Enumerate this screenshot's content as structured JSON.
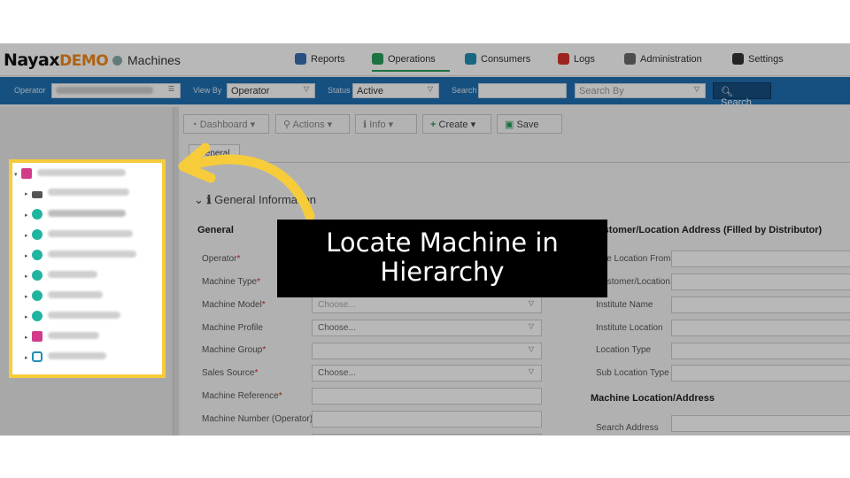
{
  "app": {
    "brand": "Nayax",
    "brand_suffix": "DEMO",
    "page": "Machines"
  },
  "nav": [
    {
      "label": "Reports",
      "icon": "reports-icon",
      "color": "#3b6fb5"
    },
    {
      "label": "Operations",
      "icon": "operations-icon",
      "color": "#2a9d5a"
    },
    {
      "label": "Consumers",
      "icon": "consumers-icon",
      "color": "#1f8fb5"
    },
    {
      "label": "Logs",
      "icon": "logs-icon",
      "color": "#d9342b"
    },
    {
      "label": "Administration",
      "icon": "administration-icon",
      "color": "#6b6b6b"
    },
    {
      "label": "Settings",
      "icon": "settings-icon",
      "color": "#333333"
    }
  ],
  "filters": {
    "operator_label": "Operator",
    "viewby_label": "View By",
    "viewby_value": "Operator",
    "status_label": "Status",
    "status_value": "Active",
    "search_label": "Search",
    "search_by_placeholder": "Search By",
    "search_button": "Search"
  },
  "toolbar": {
    "dashboard": "Dashboard",
    "actions": "Actions",
    "info": "Info",
    "create": "Create",
    "save": "Save"
  },
  "tabs": {
    "general": "General"
  },
  "form": {
    "section_title": "General Information",
    "general_header": "General",
    "fields": [
      {
        "label": "Operator",
        "required": true,
        "value": ""
      },
      {
        "label": "Machine Type",
        "required": true,
        "value": ""
      },
      {
        "label": "Machine Model",
        "required": true,
        "value": "Choose..."
      },
      {
        "label": "Machine Profile",
        "required": false,
        "value": "Choose..."
      },
      {
        "label": "Machine Group",
        "required": true,
        "value": ""
      },
      {
        "label": "Sales Source",
        "required": true,
        "value": "Choose..."
      },
      {
        "label": "Machine Reference",
        "required": true,
        "value": ""
      },
      {
        "label": "Machine Number (Operator)",
        "required": false,
        "value": ""
      }
    ],
    "customer_header": "Customer/Location Address (Filled by Distributor)",
    "customer_fields": [
      "Use Location From",
      "Customer/Location",
      "Institute Name",
      "Institute Location",
      "Location Type",
      "Sub Location Type"
    ],
    "machine_location_header": "Machine Location/Address",
    "search_address": "Search Address"
  },
  "caption": {
    "line1": "Locate Machine in",
    "line2": "Hierarchy"
  },
  "colors": {
    "highlight": "#f6cc3b",
    "filterbar": "#1f6fb2",
    "accent": "#f28a1e"
  }
}
